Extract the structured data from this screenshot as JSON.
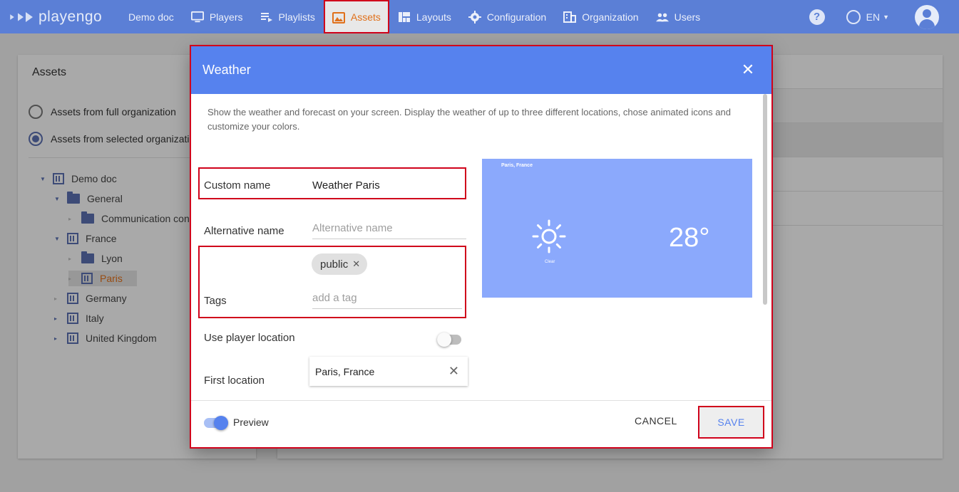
{
  "app": {
    "logo_text": "playengo"
  },
  "nav": {
    "items": [
      {
        "label": "Demo doc",
        "icon": "none"
      },
      {
        "label": "Players",
        "icon": "monitor-icon"
      },
      {
        "label": "Playlists",
        "icon": "playlist-icon"
      },
      {
        "label": "Assets",
        "icon": "image-icon"
      },
      {
        "label": "Layouts",
        "icon": "layout-icon"
      },
      {
        "label": "Configuration",
        "icon": "gear-icon"
      },
      {
        "label": "Organization",
        "icon": "building-icon"
      },
      {
        "label": "Users",
        "icon": "users-icon"
      }
    ],
    "active": "Assets",
    "help_label": "?",
    "language": "EN"
  },
  "assets_panel": {
    "title": "Assets",
    "scope_options": [
      {
        "label": "Assets from full organization",
        "selected": false
      },
      {
        "label": "Assets from selected organizatio",
        "selected": true
      }
    ],
    "tree": [
      {
        "label": "Demo doc",
        "type": "org",
        "level": 0,
        "expanded": true
      },
      {
        "label": "General",
        "type": "folder",
        "level": 1,
        "expanded": true
      },
      {
        "label": "Communication cont",
        "type": "folder",
        "level": 2,
        "expanded": false
      },
      {
        "label": "France",
        "type": "org",
        "level": 1,
        "expanded": true
      },
      {
        "label": "Lyon",
        "type": "folder",
        "level": 2,
        "expanded": false
      },
      {
        "label": "Paris",
        "type": "org",
        "level": 2,
        "expanded": false,
        "selected": true
      },
      {
        "label": "Germany",
        "type": "org",
        "level": 1,
        "expanded": false
      },
      {
        "label": "Italy",
        "type": "org",
        "level": 1,
        "expanded": false
      },
      {
        "label": "United Kingdom",
        "type": "org",
        "level": 1,
        "expanded": false
      }
    ]
  },
  "dialog": {
    "title": "Weather",
    "description": "Show the weather and forecast on your screen. Display the weather of up to three different locations, chose animated icons and customize your colors.",
    "fields": {
      "custom_name_label": "Custom name",
      "custom_name_value": "Weather Paris",
      "alt_name_label": "Alternative name",
      "alt_name_placeholder": "Alternative name",
      "tags_label": "Tags",
      "tags": [
        "public"
      ],
      "tag_placeholder": "add a tag",
      "use_location_label": "Use player location",
      "use_location_on": false,
      "first_location_label": "First location",
      "first_location_value": "Paris, France"
    },
    "preview": {
      "location": "Paris, France",
      "condition": "Clear",
      "temperature": "28°"
    },
    "footer": {
      "preview_label": "Preview",
      "preview_on": true,
      "cancel_label": "CANCEL",
      "save_label": "SAVE"
    }
  },
  "colors": {
    "topbar": "#5b7fd6",
    "dialog_header": "#5682ee",
    "preview_bg": "#8ba9fc",
    "highlight": "#d0021b",
    "active_nav_text": "#e0701a"
  }
}
